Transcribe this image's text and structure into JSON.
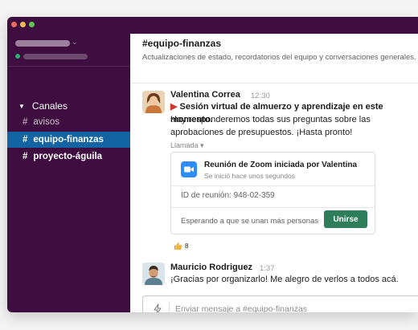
{
  "sidebar": {
    "channels_header": "Canales",
    "channels": [
      {
        "label": "avisos"
      },
      {
        "label": "equipo-finanzas"
      },
      {
        "label": "proyecto-águila"
      }
    ]
  },
  "channel": {
    "name": "#equipo-finanzas",
    "topic": "Actualizaciones de estado, recordatorios del equipo y conversaciones generales."
  },
  "messages": [
    {
      "author": "Valentina Correa",
      "time": "12:30",
      "line1": "Sesión virtual de almuerzo y aprendizaje en este momento.",
      "line2": "Hoy responderemos todas sus preguntas sobre las",
      "line3": "aprobaciones de presupuestos. ¡Hasta pronto!"
    },
    {
      "author": "Mauricio Rodriguez",
      "time": "1:37",
      "line1": "¡Gracias por organizarlo! Me alegro de verlos a todos acá."
    }
  ],
  "call": {
    "label": "Llamada",
    "title": "Reunión de Zoom iniciada por Valentina",
    "subtitle": "Se inició hace unos segundos",
    "meeting_id": "ID de reunión: 948-02-359",
    "waiting": "Esperando a que se unan más personas",
    "join_label": "Unirse"
  },
  "reaction": {
    "emoji": "thumbs-up",
    "count": "8"
  },
  "composer": {
    "placeholder": "Enviar mensaje a #equipo-finanzas"
  },
  "colors": {
    "sidebar": "#3f0e40",
    "active_channel": "#1264a3",
    "join_button": "#2e7d5b",
    "zoom_blue": "#2d8cff"
  }
}
